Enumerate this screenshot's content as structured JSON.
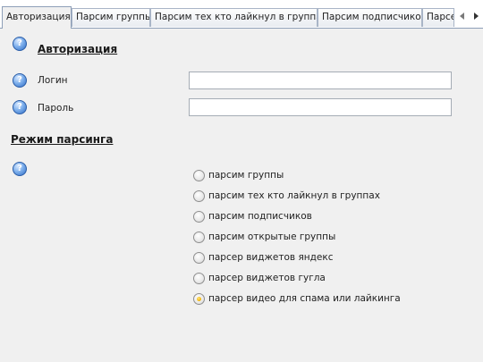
{
  "tabs": [
    {
      "label": "Авторизация",
      "active": true
    },
    {
      "label": "Парсим группы",
      "active": false
    },
    {
      "label": "Парсим тех кто лайкнул в группах",
      "active": false
    },
    {
      "label": "Парсим подписчиков",
      "active": false
    },
    {
      "label": "Парсе",
      "active": false
    }
  ],
  "auth": {
    "heading": "Авторизация",
    "login_label": "Логин",
    "login_value": "",
    "password_label": "Пароль",
    "password_value": ""
  },
  "mode": {
    "heading": "Режим парсинга",
    "options": [
      {
        "label": "парсим группы",
        "checked": false
      },
      {
        "label": "парсим тех кто лайкнул в группах",
        "checked": false
      },
      {
        "label": "парсим подписчиков",
        "checked": false
      },
      {
        "label": "парсим открытые группы",
        "checked": false
      },
      {
        "label": "парсер виджетов яндекс",
        "checked": false
      },
      {
        "label": "парсер виджетов гугла",
        "checked": false
      },
      {
        "label": "парсер видео для спама или лайкинга",
        "checked": true
      }
    ]
  },
  "icons": {
    "help": "help-icon",
    "scroll_left": "chevron-left-icon",
    "scroll_right": "chevron-right-icon"
  },
  "colors": {
    "panel_bg": "#f0f0f0",
    "help_blue": "#2e6cc5",
    "radio_selected": "#f0b000"
  }
}
